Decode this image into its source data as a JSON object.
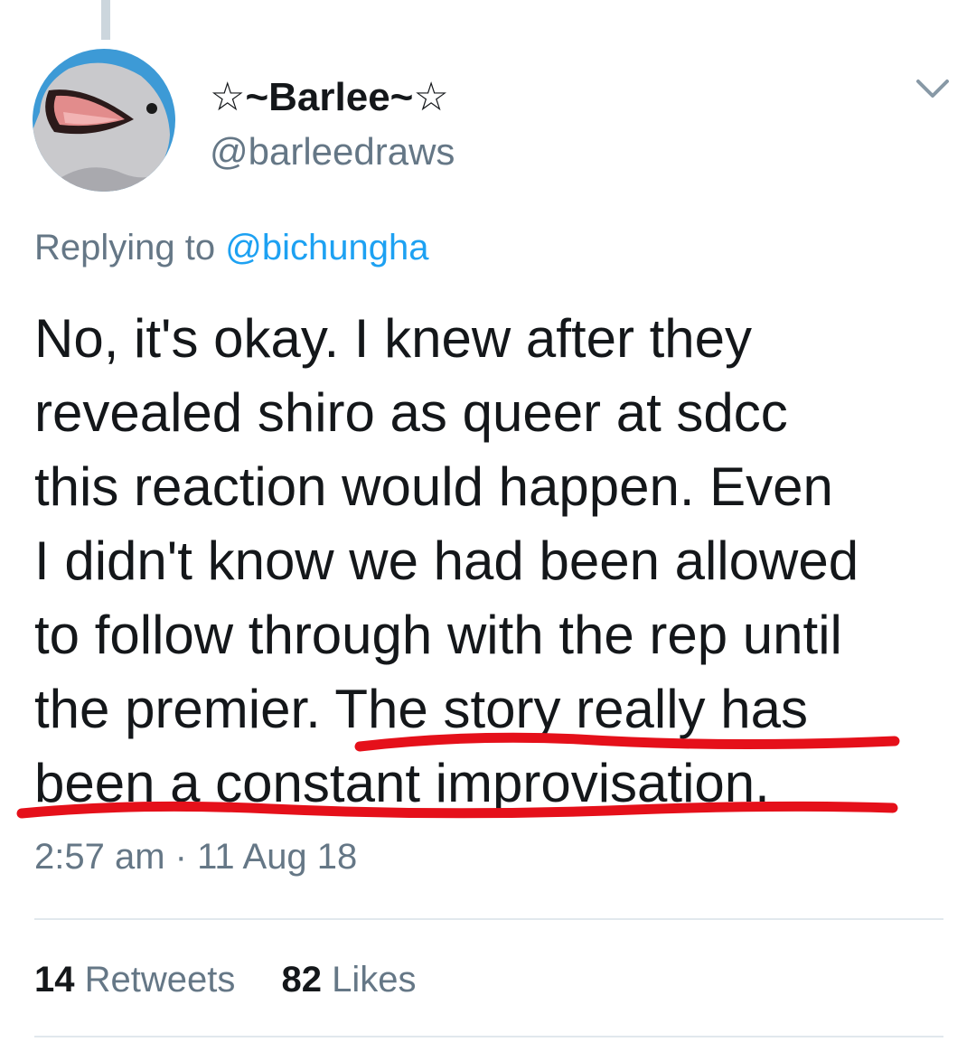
{
  "tweet": {
    "author": {
      "display_name": "☆~Barlee~☆",
      "handle": "@barleedraws",
      "avatar_icon": "dolphin-avatar-icon"
    },
    "menu_icon": "chevron-down-icon",
    "replying_to": {
      "prefix": "Replying to ",
      "mention": "@bichungha"
    },
    "text_lines": [
      "No, it's okay. I knew after they",
      "revealed shiro as queer at sdcc",
      "this reaction would happen. Even",
      "I didn't know we had been allowed",
      "to follow through with the rep until"
    ],
    "text_line6_plain": "the premier. ",
    "text_line6_highlight": "The story really has",
    "text_line7_highlight": "been a constant improvisation.",
    "timestamp": "2:57 am · 11 Aug 18",
    "stats": {
      "retweets_count": "14",
      "retweets_label": " Retweets",
      "likes_count": "82",
      "likes_label": " Likes"
    }
  },
  "colors": {
    "text": "#14171a",
    "secondary": "#657786",
    "link": "#1da1f2",
    "underline_mark": "#e5101a",
    "divider": "#e1e8ed"
  }
}
